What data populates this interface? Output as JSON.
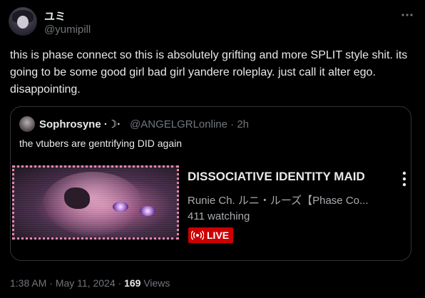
{
  "tweet": {
    "display_name": "ユミ",
    "handle": "@yumipill",
    "avatar_icon": "user-avatar",
    "more_icon": "more-horizontal-icon",
    "text": "this is phase connect so this is absolutely grifting and more SPLIT style shit. its going to be some good girl bad girl yandere roleplay. just call it alter ego. disappointing."
  },
  "quote": {
    "display_name": "Sophrosyne ·☽·",
    "handle": "@ANGELGRLonline",
    "time_sep": " · ",
    "time": "2h",
    "text": "the vtubers are gentrifying DID again",
    "embed": {
      "title": "DISSOCIATIVE IDENTITY MAID",
      "channel": "Runie Ch. ルニ・ルーズ【Phase Co...",
      "watching": "411 watching",
      "live_label": "LIVE",
      "menu_icon": "vertical-dots-icon",
      "live_icon": "broadcast-icon",
      "border_color": "#e88aa8",
      "live_color": "#cc0000"
    }
  },
  "meta": {
    "time": "1:38 AM",
    "sep1": " · ",
    "date": "May 11, 2024",
    "sep2": " · ",
    "views_count": "169",
    "views_label": " Views"
  },
  "colors": {
    "background": "#000000",
    "text": "#e7e9ea",
    "secondary": "#71767b",
    "border": "#2f3336"
  }
}
